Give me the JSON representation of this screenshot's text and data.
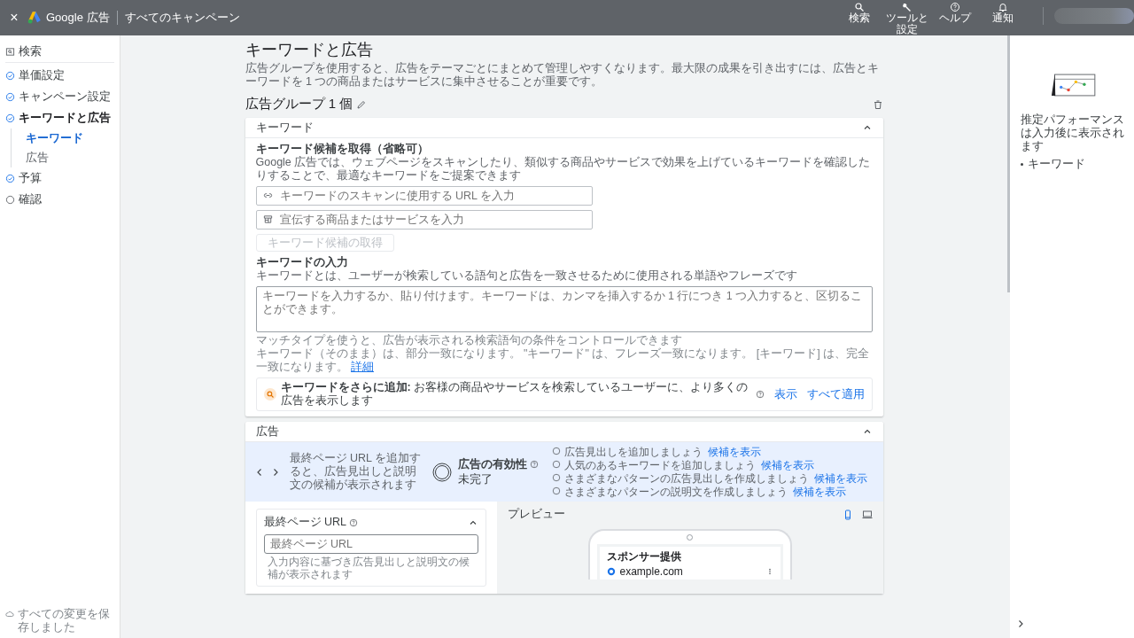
{
  "topbar": {
    "close": "×",
    "product": "Google 広告",
    "breadcrumb": "すべてのキャンペーン",
    "actions": [
      {
        "kind": "search",
        "label": "検索"
      },
      {
        "kind": "tools",
        "label": "ツールと設定"
      },
      {
        "kind": "help",
        "label": "ヘルプ"
      },
      {
        "kind": "bell",
        "label": "通知"
      }
    ]
  },
  "sidebar": {
    "items": [
      {
        "kind": "search",
        "label": "検索",
        "selected": false
      },
      {
        "kind": "step",
        "label": "単価設定",
        "done": true,
        "selected": false
      },
      {
        "kind": "step",
        "label": "キャンペーン設定",
        "done": true,
        "selected": false
      },
      {
        "kind": "step",
        "label": "キーワードと広告",
        "done": true,
        "selected": true,
        "children": [
          {
            "label": "キーワード",
            "selected": true
          },
          {
            "label": "広告",
            "selected": false
          }
        ]
      },
      {
        "kind": "step",
        "label": "予算",
        "done": true,
        "selected": false
      },
      {
        "kind": "step",
        "label": "確認",
        "done": false,
        "selected": false
      }
    ],
    "footer": "すべての変更を保存しました"
  },
  "main": {
    "title": "キーワードと広告",
    "description": "広告グループを使用すると、広告をテーマごとにまとめて管理しやすくなります。最大限の成果を引き出すには、広告とキーワードを 1 つの商品またはサービスに集中させることが重要です。",
    "ad_group": {
      "title": "広告グループ 1 個"
    },
    "keywords_panel": {
      "header": "キーワード",
      "expanded": true,
      "suggest": {
        "title": "キーワード候補を取得（省略可）",
        "description": "Google 広告では、ウェブページをスキャンしたり、類似する商品やサービスで効果を上げているキーワードを確認したりすることで、最適なキーワードをご提案できます",
        "url_placeholder": "キーワードのスキャンに使用する URL を入力",
        "product_placeholder": "宣伝する商品またはサービスを入力",
        "button": {
          "label": "キーワード候補の取得",
          "disabled": true
        }
      },
      "entry": {
        "title": "キーワードの入力",
        "description": "キーワードとは、ユーザーが検索している語句と広告を一致させるために使用される単語やフレーズです",
        "placeholder": "キーワードを入力するか、貼り付けます。キーワードは、カンマを挿入するか 1 行につき 1 つ入力すると、区切ることができます。",
        "hint": "マッチタイプを使うと、広告が表示される検索語句の条件をコントロールできます",
        "match_note": "キーワード（そのまま）は、部分一致になります。 \"キーワード\" は、フレーズ一致になります。 [キーワード] は、完全一致になります。",
        "details_link": "詳細"
      },
      "more": {
        "text": "**キーワードをさらに追加:** お客様の商品やサービスを検索しているユーザーに、より多くの広告を表示します",
        "show": "表示",
        "apply_all": "すべて適用"
      }
    },
    "ads_panel": {
      "header": "広告",
      "expanded": true,
      "banner": {
        "message": "最終ページ URL を追加すると、広告見出しと説明文の候補が表示されます",
        "strength_label": "広告の有効性",
        "strength_value": "未完了",
        "tips": [
          {
            "text": "広告見出しを追加しましょう",
            "link": "候補を表示",
            "done": false
          },
          {
            "text": "人気のあるキーワードを追加しましょう",
            "link": "候補を表示",
            "done": false
          },
          {
            "text": "さまざまなパターンの広告見出しを作成しましょう",
            "link": "候補を表示",
            "done": false
          },
          {
            "text": "さまざまなパターンの説明文を作成しましょう",
            "link": "候補を表示",
            "done": false
          }
        ]
      },
      "final_url": {
        "title": "最終ページ URL",
        "expanded": true,
        "placeholder": "最終ページ URL",
        "helper": "入力内容に基づき広告見出しと説明文の候補が表示されます"
      },
      "preview": {
        "title": "プレビュー",
        "devices": [
          {
            "kind": "mobile",
            "selected": true
          },
          {
            "kind": "desktop",
            "selected": false
          }
        ],
        "sponsored": "スポンサー提供",
        "domain": "example.com"
      }
    }
  },
  "right_panel": {
    "message": "推定パフォーマンスは入力後に表示されます",
    "items": [
      "キーワード"
    ]
  }
}
